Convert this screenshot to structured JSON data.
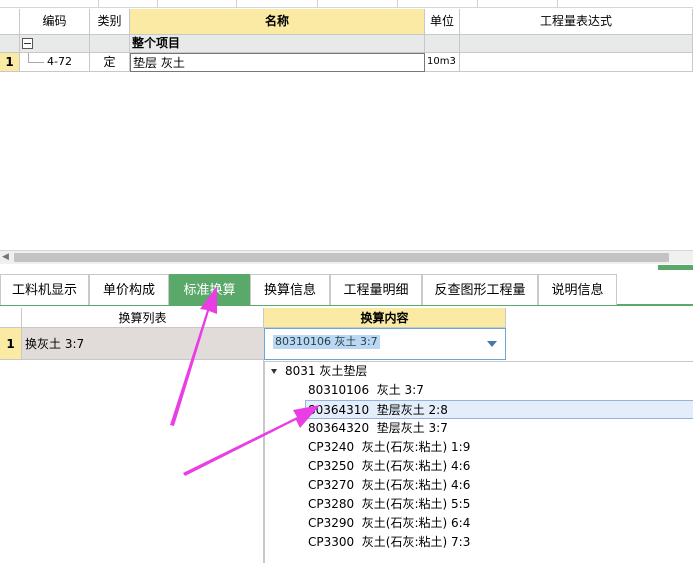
{
  "grid": {
    "headers": {
      "code": "编码",
      "type": "类别",
      "name": "名称",
      "unit": "单位",
      "expression": "工程量表达式"
    },
    "group_row": {
      "toggle": "−",
      "name": "整个项目"
    },
    "rows": [
      {
        "index": "1",
        "code": "4-72",
        "type": "定",
        "name": "垫层 灰土",
        "unit": "10m3",
        "expression": ""
      }
    ]
  },
  "tabs": [
    {
      "label": "工料机显示"
    },
    {
      "label": "单价构成"
    },
    {
      "label": "标准换算"
    },
    {
      "label": "换算信息"
    },
    {
      "label": "工程量明细"
    },
    {
      "label": "反查图形工程量"
    },
    {
      "label": "说明信息"
    }
  ],
  "active_tab": 2,
  "conversion": {
    "list_header": "换算列表",
    "content_header": "换算内容",
    "rows": [
      {
        "index": "1",
        "label": "换灰土 3:7"
      }
    ],
    "combo_value": "80310106   灰土 3:7"
  },
  "dropdown": {
    "group": "8031 灰土垫层",
    "items": [
      {
        "code": "80310106",
        "name": "灰土 3:7"
      },
      {
        "code": "80364310",
        "name": "垫层灰土 2:8"
      },
      {
        "code": "80364320",
        "name": "垫层灰土 3:7"
      },
      {
        "code": "CP3240",
        "name": "灰土(石灰:粘土) 1:9"
      },
      {
        "code": "CP3250",
        "name": "灰土(石灰:粘土) 4:6"
      },
      {
        "code": "CP3270",
        "name": "灰土(石灰:粘土) 4:6"
      },
      {
        "code": "CP3280",
        "name": "灰土(石灰:粘土) 5:5"
      },
      {
        "code": "CP3290",
        "name": "灰土(石灰:粘土) 6:4"
      },
      {
        "code": "CP3300",
        "name": "灰土(石灰:粘土) 7:3"
      }
    ],
    "selected_index": 1
  },
  "icons": {
    "collapse": "minus-square-icon",
    "combo_arrow": "chevron-down-icon",
    "tree": "triangle-down-icon",
    "scroll_left": "arrow-left-icon"
  },
  "colors": {
    "accent_green": "#5aa86a",
    "header_yellow": "#fbeaa3",
    "annotation_arrow": "#e93ee4"
  }
}
